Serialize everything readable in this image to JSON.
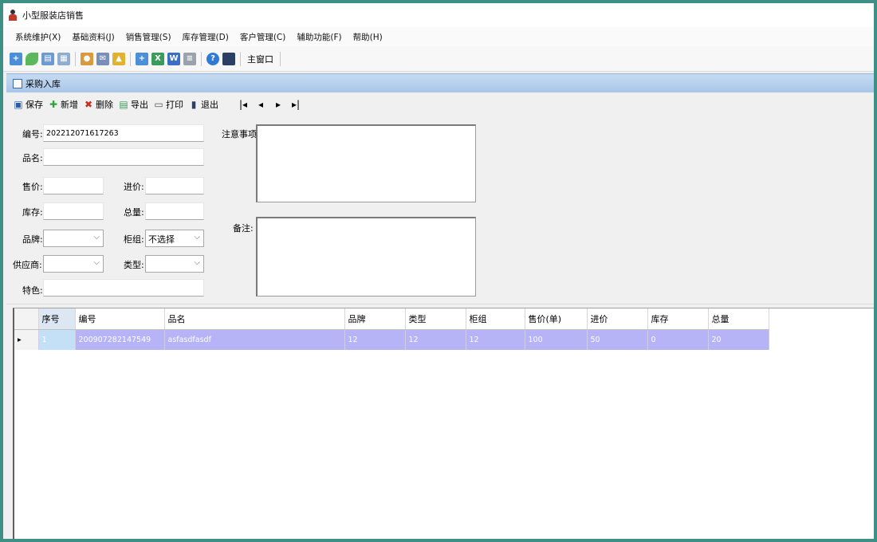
{
  "window": {
    "title": "小型服装店销售"
  },
  "menu": {
    "items": [
      "系统维护(X)",
      "基础资料(J)",
      "销售管理(S)",
      "库存管理(D)",
      "客户管理(C)",
      "辅助功能(F)",
      "帮助(H)"
    ]
  },
  "toolbar": {
    "main_window_label": "主窗口"
  },
  "panel": {
    "title": "采购入库"
  },
  "actions": {
    "save": "保存",
    "add": "新增",
    "delete": "删除",
    "export": "导出",
    "print": "打印",
    "exit": "退出"
  },
  "form": {
    "code_label": "编号:",
    "code_value": "202212071617263",
    "name_label": "品名:",
    "name_value": "",
    "price_label": "售价:",
    "price_value": "",
    "cost_label": "进价:",
    "cost_value": "",
    "stock_label": "库存:",
    "stock_value": "",
    "total_label": "总量:",
    "total_value": "",
    "brand_label": "品牌:",
    "brand_value": "",
    "cabinet_label": "柜组:",
    "cabinet_value": "不选择",
    "supplier_label": "供应商:",
    "supplier_value": "",
    "type_label": "类型:",
    "type_value": "",
    "feature_label": "特色:",
    "feature_value": "",
    "notes_label": "注意事项:",
    "remark_label": "备注:"
  },
  "grid": {
    "columns": [
      "序号",
      "编号",
      "品名",
      "品牌",
      "类型",
      "柜组",
      "售价(单)",
      "进价",
      "库存",
      "总量"
    ],
    "rows": [
      [
        "1",
        "200907282147549",
        "asfasdfasdf",
        "12",
        "12",
        "12",
        "100",
        "50",
        "0",
        "20"
      ]
    ],
    "row_indicator": "▸"
  }
}
